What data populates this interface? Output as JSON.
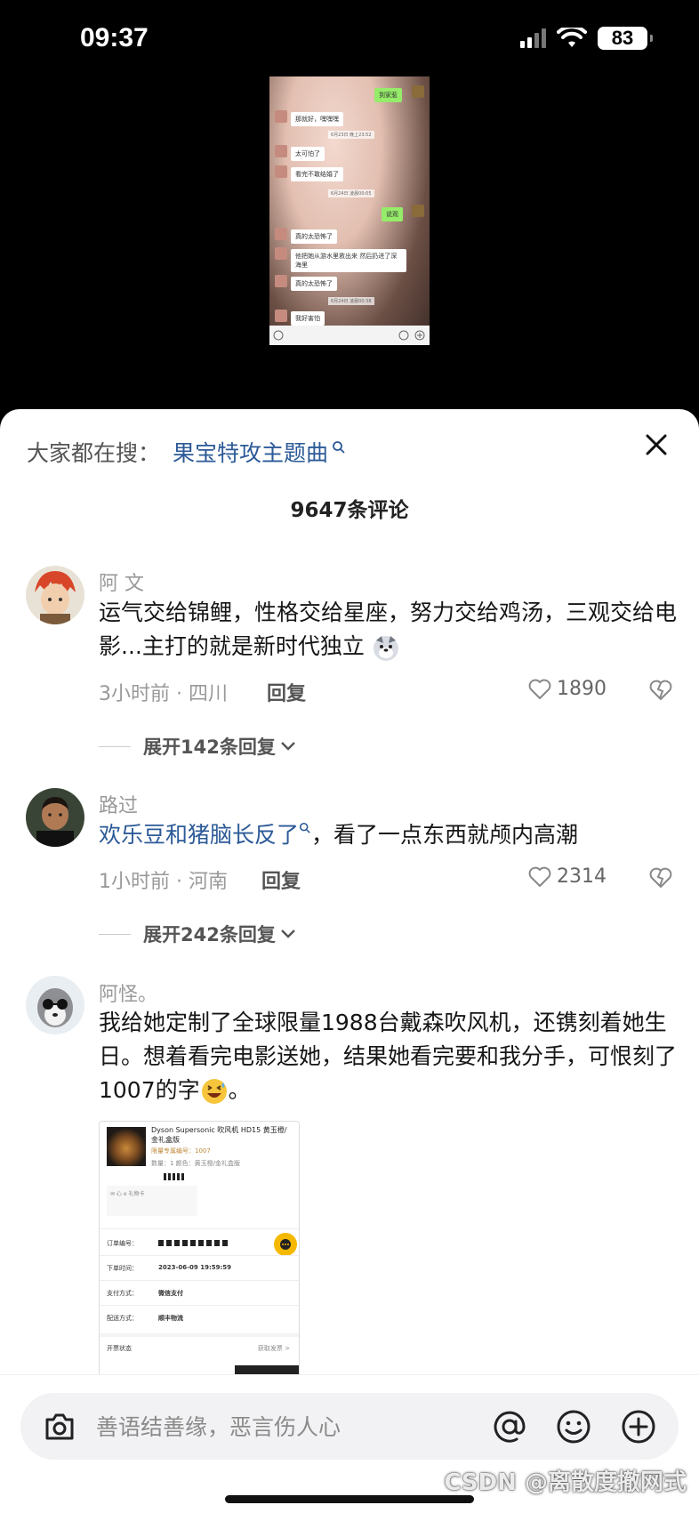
{
  "status": {
    "time": "09:37",
    "battery": "83"
  },
  "video": {
    "bubbles": [
      {
        "text": "到家惹",
        "green": true
      },
      {
        "text": "那就好，嘿嘿嘿"
      },
      {
        "text": "太可怕了"
      },
      {
        "text": "看完不敢结婚了"
      },
      {
        "text": "说观",
        "green": true
      },
      {
        "text": "真的太恐怖了"
      },
      {
        "text": "他把她从游水里救出来 然后扔进了深海里"
      },
      {
        "text": "真的太恐怖了"
      },
      {
        "text": "我好害怕"
      }
    ],
    "timestamps": [
      "6月23日 晚上23:52",
      "6月24日 凌晨00:05",
      "6月24日 凌晨00:38"
    ]
  },
  "header": {
    "search_prefix": "大家都在搜：",
    "search_link": "果宝特攻主题曲",
    "comment_count": "9647条评论"
  },
  "comments": [
    {
      "name": "阿 文",
      "text": "运气交给锦鲤，性格交给星座，努力交给鸡汤，三观交给电影...主打的就是新时代独立",
      "meta": "3小时前 · 四川",
      "reply": "回复",
      "likes": "1890",
      "expand": "展开142条回复"
    },
    {
      "name": "路过",
      "text_link": "欢乐豆和猪脑长反了",
      "text": "，看了一点东西就颅内高潮",
      "meta": "1小时前 · 河南",
      "reply": "回复",
      "likes": "2314",
      "expand": "展开242条回复"
    },
    {
      "name": "阿怪。",
      "text": "我给她定制了全球限量1988台戴森吹风机，还镌刻着她生日。想着看完电影送她，结果她看完要和我分手，可恨刻了1007的字",
      "text_end": "。"
    }
  ],
  "receipt": {
    "title": "Dyson Supersonic 吹风机 HD15 黄玉橙/金礼盒版",
    "serial": "限量专属编号：1007",
    "qty": "数量：1  颜色：黄玉橙/金礼盒版",
    "card": "✉ 心 e 礼物卡",
    "rows": [
      {
        "k": "订单编号：",
        "v": ""
      },
      {
        "k": "下单时间：",
        "v": "2023-06-09 19:59:59"
      },
      {
        "k": "支付方式：",
        "v": "微信支付"
      },
      {
        "k": "配送方式：",
        "v": "顺丰物流"
      },
      {
        "k": "开票状态",
        "v": "获取发票 >"
      }
    ]
  },
  "input": {
    "placeholder": "善语结善缘，恶言伤人心"
  },
  "watermark": "CSDN @离散度撤网式"
}
